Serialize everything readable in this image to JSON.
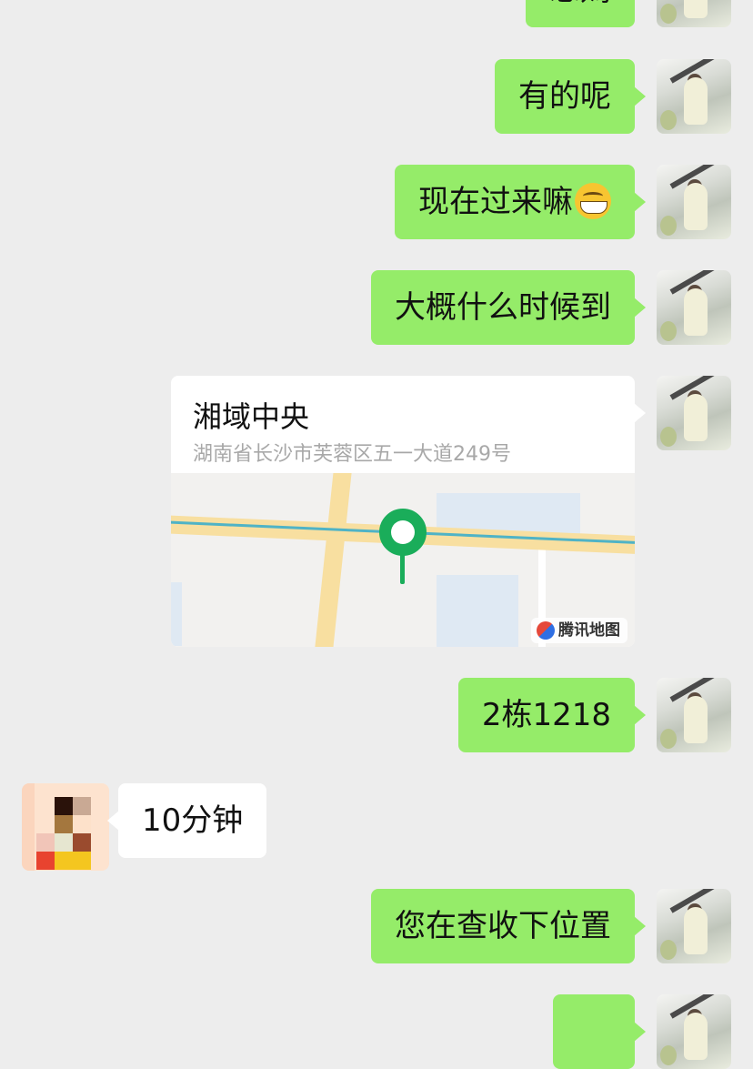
{
  "messages": [
    {
      "id": "m1",
      "side": "out",
      "text": "思媽"
    },
    {
      "id": "m2",
      "side": "out",
      "text": "有的呢"
    },
    {
      "id": "m3",
      "side": "out",
      "text": "现在过来嘛"
    },
    {
      "id": "m4",
      "side": "out",
      "text": "大概什么时候到"
    },
    {
      "id": "m6",
      "side": "out",
      "text": "2栋1218"
    },
    {
      "id": "m7",
      "side": "in",
      "text": "10分钟"
    },
    {
      "id": "m8",
      "side": "out",
      "text": "您在查收下位置"
    }
  ],
  "location": {
    "title": "湘域中央",
    "address": "湖南省长沙市芙蓉区五一大道249号",
    "map_brand": "腾讯地图"
  },
  "icons": {
    "grin_emoji": "grinning-face-with-teeth",
    "map_pin": "map-pin-icon",
    "brand_logo": "tencent-map-logo"
  },
  "colors": {
    "outgoing_bubble": "#95ec69",
    "incoming_bubble": "#ffffff",
    "background": "#ededed",
    "pin": "#1aad5a"
  }
}
